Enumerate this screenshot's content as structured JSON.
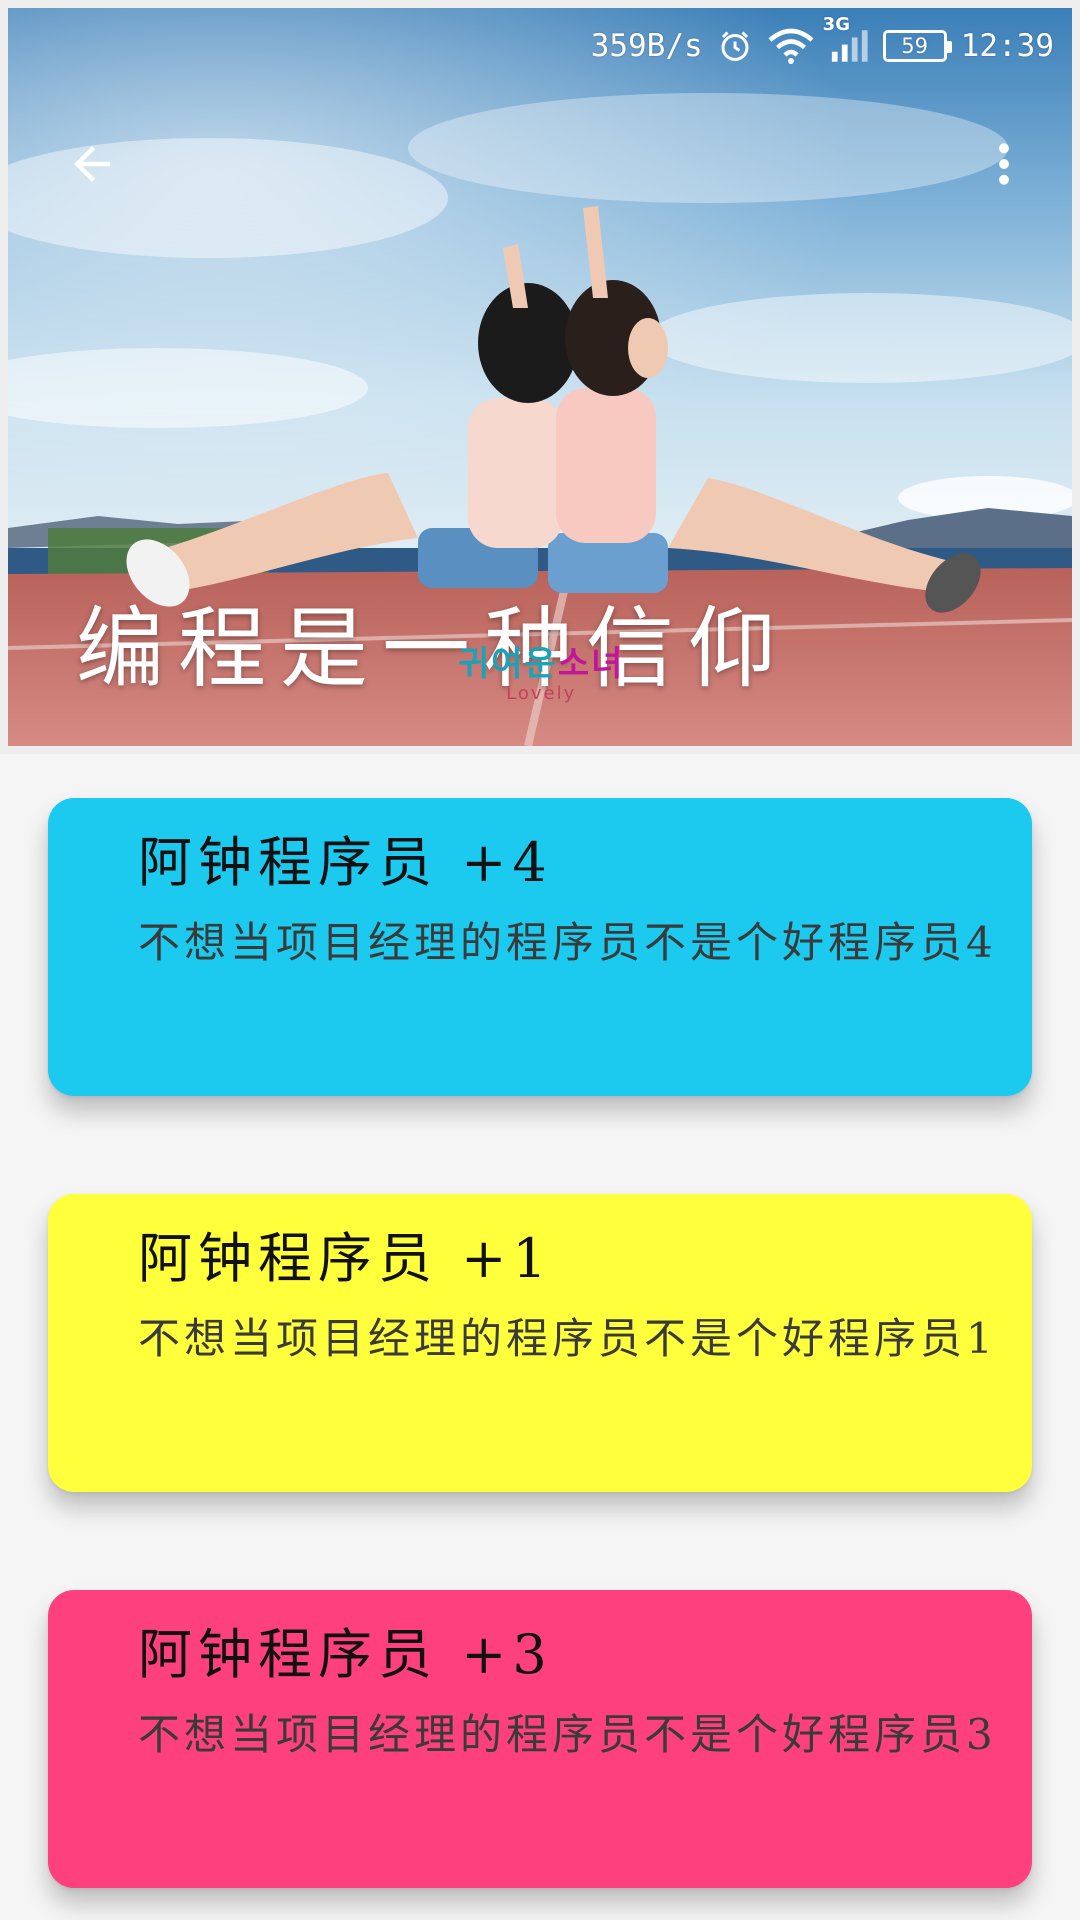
{
  "status_bar": {
    "net_speed": "359B/s",
    "network_type": "3G",
    "battery_level": "59",
    "time": "12:39",
    "icons": [
      "alarm-icon",
      "wifi-icon",
      "signal-icon",
      "battery-icon"
    ]
  },
  "toolbar": {
    "back_icon": "arrow-back-icon",
    "more_icon": "more-vert-icon"
  },
  "header": {
    "title": "编程是一种信仰",
    "image_overlay_text": "귀여운소녀",
    "image_overlay_sub": "Lovely"
  },
  "cards": [
    {
      "title": "阿钟程序员  +4",
      "body": "不想当项目经理的程序员不是个好程序员4",
      "color": "#1dcaef"
    },
    {
      "title": "阿钟程序员  +1",
      "body": "不想当项目经理的程序员不是个好程序员1",
      "color": "#ffff3b"
    },
    {
      "title": "阿钟程序员  +3",
      "body": "不想当项目经理的程序员不是个好程序员3",
      "color": "#ff407f"
    }
  ]
}
